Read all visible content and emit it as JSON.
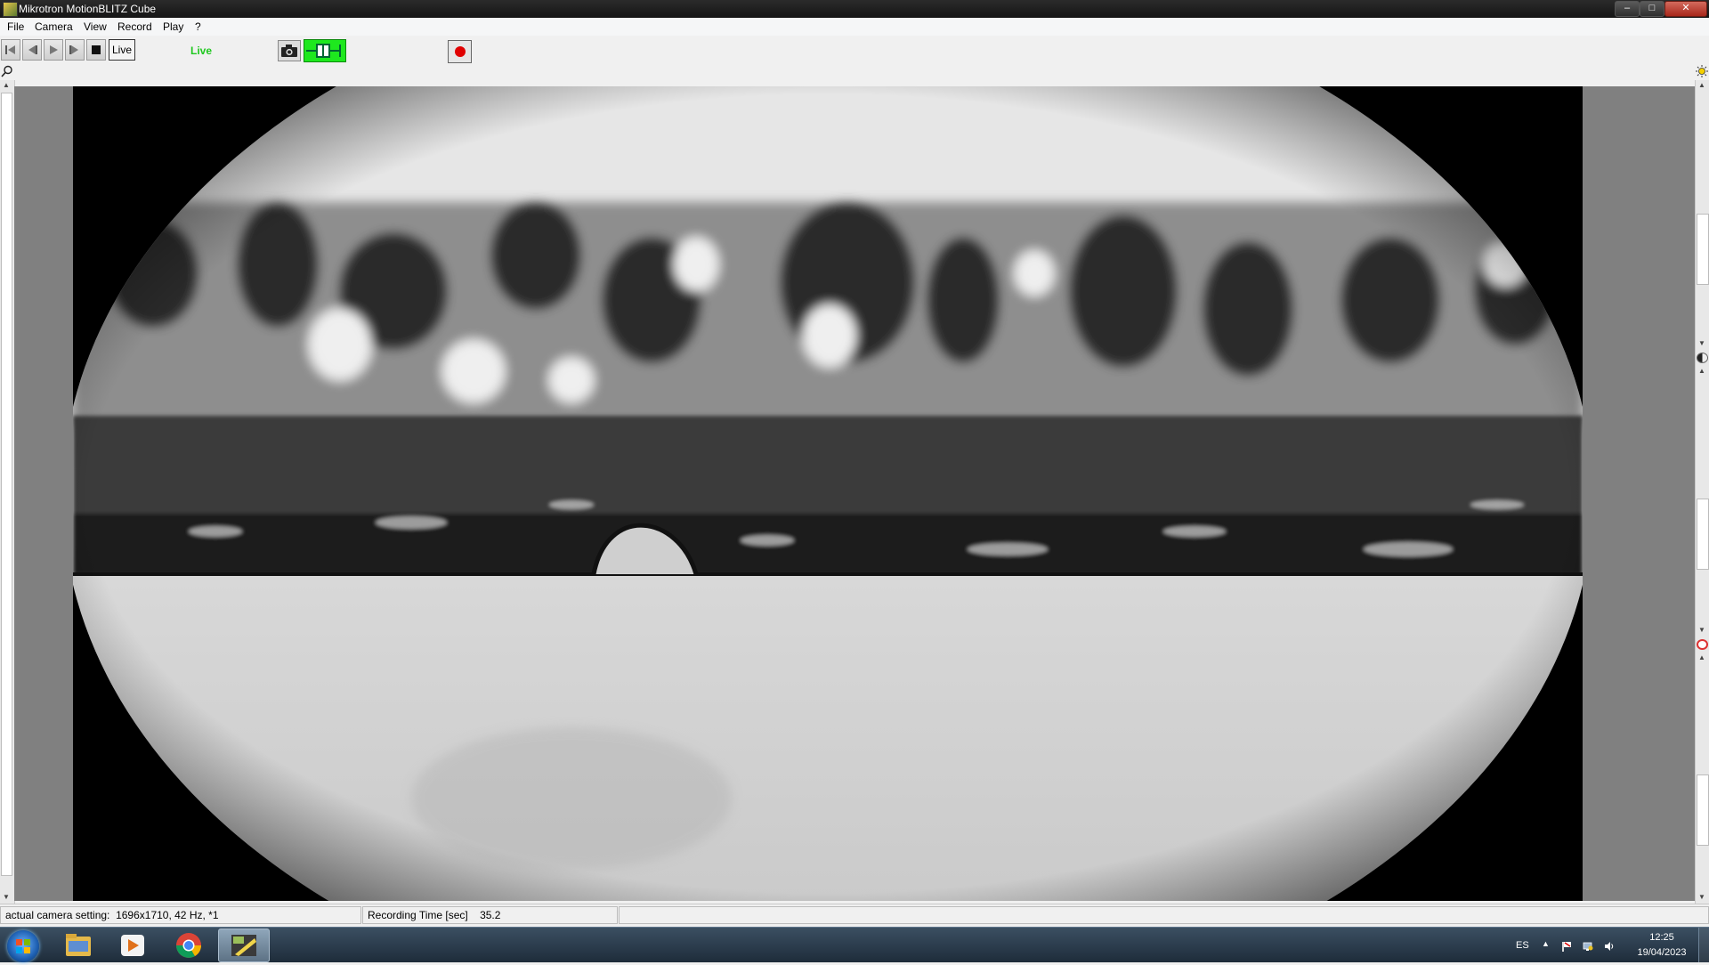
{
  "window": {
    "title": "Mikrotron MotionBLITZ Cube",
    "controls": {
      "minimize": "–",
      "maximize": "□",
      "close": "✕"
    }
  },
  "menu": {
    "items": [
      "File",
      "Camera",
      "View",
      "Record",
      "Play",
      "?"
    ]
  },
  "toolbar": {
    "buttons": [
      "skip-back",
      "step-back",
      "play",
      "step-forward",
      "stop"
    ],
    "live_button_label": "Live",
    "live_status": "Live",
    "icons": {
      "snapshot": "camera-icon",
      "trigger": "trigger-icon",
      "record": "record-icon"
    },
    "colors": {
      "live_status": "#1ec81e",
      "trigger_active": "#1ee81e",
      "record": "#e00000"
    }
  },
  "viewer": {
    "icons": {
      "zoom": "zoom-icon",
      "brightness": "brightness-icon"
    },
    "image_description_tone": "grayscale"
  },
  "status": {
    "camera_setting_label": "actual camera setting:",
    "camera_setting_value": "1696x1710, 42 Hz, *1",
    "recording_time_label": "Recording Time [sec]",
    "recording_time_value": "35.2"
  },
  "taskbar": {
    "apps": [
      "start",
      "file-explorer",
      "media-player",
      "chrome",
      "motionblitz"
    ],
    "language": "ES",
    "time": "12:25",
    "date": "19/04/2023"
  }
}
